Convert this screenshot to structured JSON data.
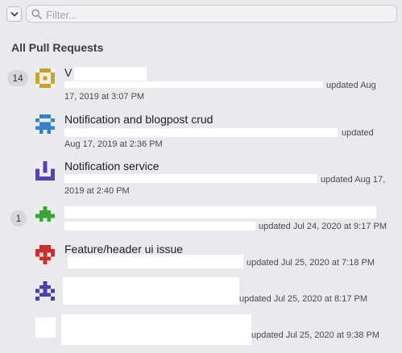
{
  "toolbar": {
    "filter_placeholder": "Filter...",
    "collapse_icon": "chevron-down-icon",
    "search_icon": "magnifying-glass-icon"
  },
  "section": {
    "title": "All Pull Requests"
  },
  "groups": [
    {
      "count": "14"
    },
    {
      "count": "1"
    }
  ],
  "pull_requests": [
    {
      "title": "V",
      "updated_line1": "updated Aug",
      "updated_line2": "17, 2019 at 3:07 PM",
      "avatar_color": "#c9a227"
    },
    {
      "title": "Notification and blogpost crud",
      "updated_line1": "updated",
      "updated_line2": "Aug 17, 2019 at 2:36 PM",
      "avatar_color": "#3b7fcf"
    },
    {
      "title": "Notification service",
      "updated_line1": "updated Aug 17,",
      "updated_line2": "2019 at 2:40 PM",
      "avatar_color": "#5b3fb6"
    },
    {
      "title": "",
      "updated_line1": "updated Jul 24, 2020 at 9:17 PM",
      "updated_line2": "",
      "avatar_color": "#3aa33a"
    },
    {
      "title": "Feature/header ui issue",
      "updated_line1": "updated Jul 25, 2020 at 7:18 PM",
      "updated_line2": "",
      "avatar_color": "#cc2e2e"
    },
    {
      "title": "",
      "updated_line1": "updated Jul 25, 2020 at 8:17 PM",
      "updated_line2": "",
      "avatar_color": "#4a3fb0"
    },
    {
      "title": "",
      "updated_line1": "updated Jul 25, 2020 at 9:38 PM",
      "updated_line2": "",
      "avatar_color": "#ffffff"
    }
  ],
  "colors": {
    "window_bg": "#e9eaed",
    "badge_bg": "#d6d7db",
    "redaction": "#ffffff"
  }
}
